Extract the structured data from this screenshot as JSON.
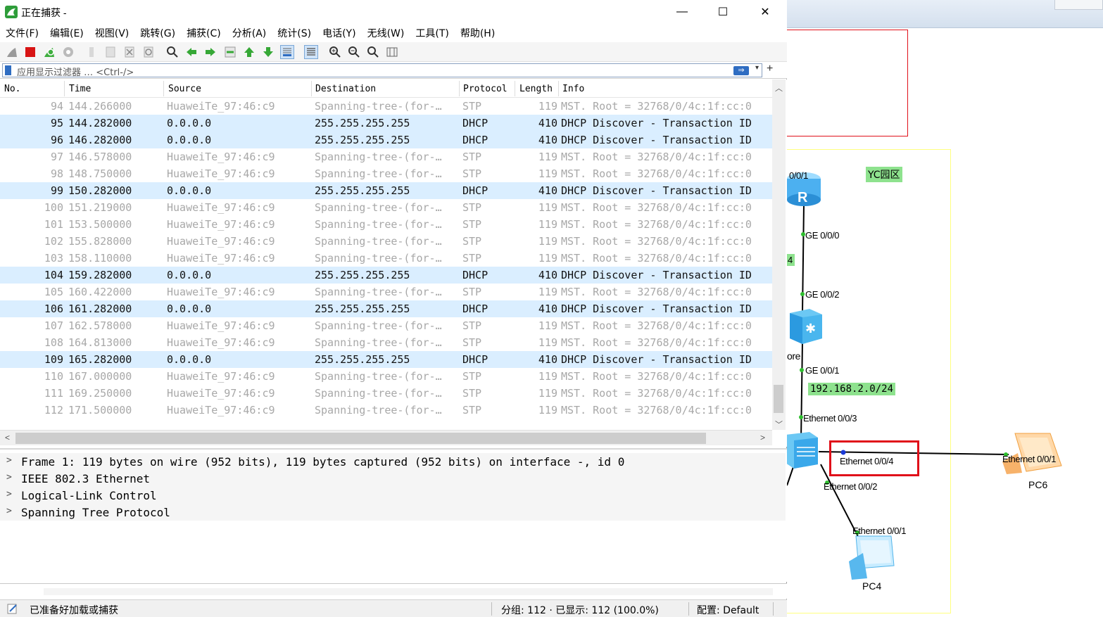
{
  "window": {
    "title": "正在捕获 -",
    "minimize": "—",
    "maximize": "☐",
    "close": "✕"
  },
  "menu": [
    "文件(F)",
    "编辑(E)",
    "视图(V)",
    "跳转(G)",
    "捕获(C)",
    "分析(A)",
    "统计(S)",
    "电话(Y)",
    "无线(W)",
    "工具(T)",
    "帮助(H)"
  ],
  "toolbar": {
    "icons": [
      "shark-fin-icon",
      "stop-capture-icon",
      "restart-capture-icon",
      "capture-options-icon",
      "open-file-icon",
      "save-file-icon",
      "close-file-icon",
      "reload-icon",
      "find-packet-icon",
      "go-back-icon",
      "go-forward-icon",
      "go-to-packet-icon",
      "go-first-icon",
      "go-last-icon",
      "autoscroll-icon",
      "colorize-icon",
      "zoom-in-icon",
      "zoom-out-icon",
      "zoom-normal-icon",
      "resize-columns-icon"
    ]
  },
  "filter": {
    "placeholder": "应用显示过滤器 … <Ctrl-/>",
    "apply": "⇒",
    "dropdown": "▾",
    "add": "+"
  },
  "packet_list": {
    "columns": [
      "No.",
      "Time",
      "Source",
      "Destination",
      "Protocol",
      "Length",
      "Info"
    ],
    "rows": [
      {
        "no": "94",
        "time": "144.266000",
        "src": "HuaweiTe_97:46:c9",
        "dst": "Spanning-tree-(for-…",
        "proto": "STP",
        "len": "119",
        "info": "MST. Root = 32768/0/4c:1f:cc:0",
        "kind": "stp"
      },
      {
        "no": "95",
        "time": "144.282000",
        "src": "0.0.0.0",
        "dst": "255.255.255.255",
        "proto": "DHCP",
        "len": "410",
        "info": "DHCP Discover - Transaction ID",
        "kind": "dhcp"
      },
      {
        "no": "96",
        "time": "146.282000",
        "src": "0.0.0.0",
        "dst": "255.255.255.255",
        "proto": "DHCP",
        "len": "410",
        "info": "DHCP Discover - Transaction ID",
        "kind": "dhcp"
      },
      {
        "no": "97",
        "time": "146.578000",
        "src": "HuaweiTe_97:46:c9",
        "dst": "Spanning-tree-(for-…",
        "proto": "STP",
        "len": "119",
        "info": "MST. Root = 32768/0/4c:1f:cc:0",
        "kind": "stp"
      },
      {
        "no": "98",
        "time": "148.750000",
        "src": "HuaweiTe_97:46:c9",
        "dst": "Spanning-tree-(for-…",
        "proto": "STP",
        "len": "119",
        "info": "MST. Root = 32768/0/4c:1f:cc:0",
        "kind": "stp"
      },
      {
        "no": "99",
        "time": "150.282000",
        "src": "0.0.0.0",
        "dst": "255.255.255.255",
        "proto": "DHCP",
        "len": "410",
        "info": "DHCP Discover - Transaction ID",
        "kind": "dhcp"
      },
      {
        "no": "100",
        "time": "151.219000",
        "src": "HuaweiTe_97:46:c9",
        "dst": "Spanning-tree-(for-…",
        "proto": "STP",
        "len": "119",
        "info": "MST. Root = 32768/0/4c:1f:cc:0",
        "kind": "stp"
      },
      {
        "no": "101",
        "time": "153.500000",
        "src": "HuaweiTe_97:46:c9",
        "dst": "Spanning-tree-(for-…",
        "proto": "STP",
        "len": "119",
        "info": "MST. Root = 32768/0/4c:1f:cc:0",
        "kind": "stp"
      },
      {
        "no": "102",
        "time": "155.828000",
        "src": "HuaweiTe_97:46:c9",
        "dst": "Spanning-tree-(for-…",
        "proto": "STP",
        "len": "119",
        "info": "MST. Root = 32768/0/4c:1f:cc:0",
        "kind": "stp"
      },
      {
        "no": "103",
        "time": "158.110000",
        "src": "HuaweiTe_97:46:c9",
        "dst": "Spanning-tree-(for-…",
        "proto": "STP",
        "len": "119",
        "info": "MST. Root = 32768/0/4c:1f:cc:0",
        "kind": "stp"
      },
      {
        "no": "104",
        "time": "159.282000",
        "src": "0.0.0.0",
        "dst": "255.255.255.255",
        "proto": "DHCP",
        "len": "410",
        "info": "DHCP Discover - Transaction ID",
        "kind": "dhcp"
      },
      {
        "no": "105",
        "time": "160.422000",
        "src": "HuaweiTe_97:46:c9",
        "dst": "Spanning-tree-(for-…",
        "proto": "STP",
        "len": "119",
        "info": "MST. Root = 32768/0/4c:1f:cc:0",
        "kind": "stp"
      },
      {
        "no": "106",
        "time": "161.282000",
        "src": "0.0.0.0",
        "dst": "255.255.255.255",
        "proto": "DHCP",
        "len": "410",
        "info": "DHCP Discover - Transaction ID",
        "kind": "dhcp"
      },
      {
        "no": "107",
        "time": "162.578000",
        "src": "HuaweiTe_97:46:c9",
        "dst": "Spanning-tree-(for-…",
        "proto": "STP",
        "len": "119",
        "info": "MST. Root = 32768/0/4c:1f:cc:0",
        "kind": "stp"
      },
      {
        "no": "108",
        "time": "164.813000",
        "src": "HuaweiTe_97:46:c9",
        "dst": "Spanning-tree-(for-…",
        "proto": "STP",
        "len": "119",
        "info": "MST. Root = 32768/0/4c:1f:cc:0",
        "kind": "stp"
      },
      {
        "no": "109",
        "time": "165.282000",
        "src": "0.0.0.0",
        "dst": "255.255.255.255",
        "proto": "DHCP",
        "len": "410",
        "info": "DHCP Discover - Transaction ID",
        "kind": "dhcp"
      },
      {
        "no": "110",
        "time": "167.000000",
        "src": "HuaweiTe_97:46:c9",
        "dst": "Spanning-tree-(for-…",
        "proto": "STP",
        "len": "119",
        "info": "MST. Root = 32768/0/4c:1f:cc:0",
        "kind": "stp"
      },
      {
        "no": "111",
        "time": "169.250000",
        "src": "HuaweiTe_97:46:c9",
        "dst": "Spanning-tree-(for-…",
        "proto": "STP",
        "len": "119",
        "info": "MST. Root = 32768/0/4c:1f:cc:0",
        "kind": "stp"
      },
      {
        "no": "112",
        "time": "171.500000",
        "src": "HuaweiTe_97:46:c9",
        "dst": "Spanning-tree-(for-…",
        "proto": "STP",
        "len": "119",
        "info": "MST. Root = 32768/0/4c:1f:cc:0",
        "kind": "stp"
      }
    ]
  },
  "details": [
    "Frame 1: 119 bytes on wire (952 bits), 119 bytes captured (952 bits) on interface -, id 0",
    "IEEE 802.3 Ethernet",
    "Logical-Link Control",
    "Spanning Tree Protocol"
  ],
  "status": {
    "ready": "已准备好加载或捕获",
    "packets": "分组: 112 · 已显示: 112 (100.0%)",
    "profile": "配置: Default"
  },
  "topology": {
    "area_label": "YC园区",
    "subnet": "192.168.2.0/24",
    "partial_label": "4",
    "core_label": "ore",
    "ports": {
      "router_port": "0/0/1",
      "router_ge": "GE 0/0/0",
      "core_up": "GE 0/0/2",
      "core_down": "GE 0/0/1",
      "access_up": "Ethernet 0/0/3",
      "access_pc6": "Ethernet 0/0/4",
      "access_pc4": "Ethernet 0/0/2",
      "pc4_port": "Ethernet 0/0/1",
      "pc6_port": "Ethernet 0/0/1"
    },
    "devices": {
      "pc4": "PC4",
      "pc6": "PC6"
    },
    "colors": {
      "highlight": "#e0101a",
      "area_border": "#ffff80",
      "label_bg": "#8ee28e"
    }
  }
}
